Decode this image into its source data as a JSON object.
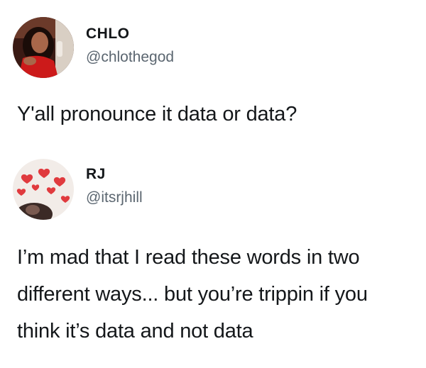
{
  "tweets": [
    {
      "display_name": "CHLO",
      "handle": "@chlothegod",
      "text": "Y'all pronounce it data or data?",
      "avatar_icon": "profile-photo-icon"
    },
    {
      "display_name": "RJ",
      "handle": "@itsrjhill",
      "text": "I’m mad that I read these words in two different ways... but you’re trippin if you think it’s data and not data",
      "avatar_icon": "profile-photo-icon"
    }
  ],
  "colors": {
    "text_primary": "#14171a",
    "text_secondary": "#5b6670",
    "background": "#ffffff"
  }
}
